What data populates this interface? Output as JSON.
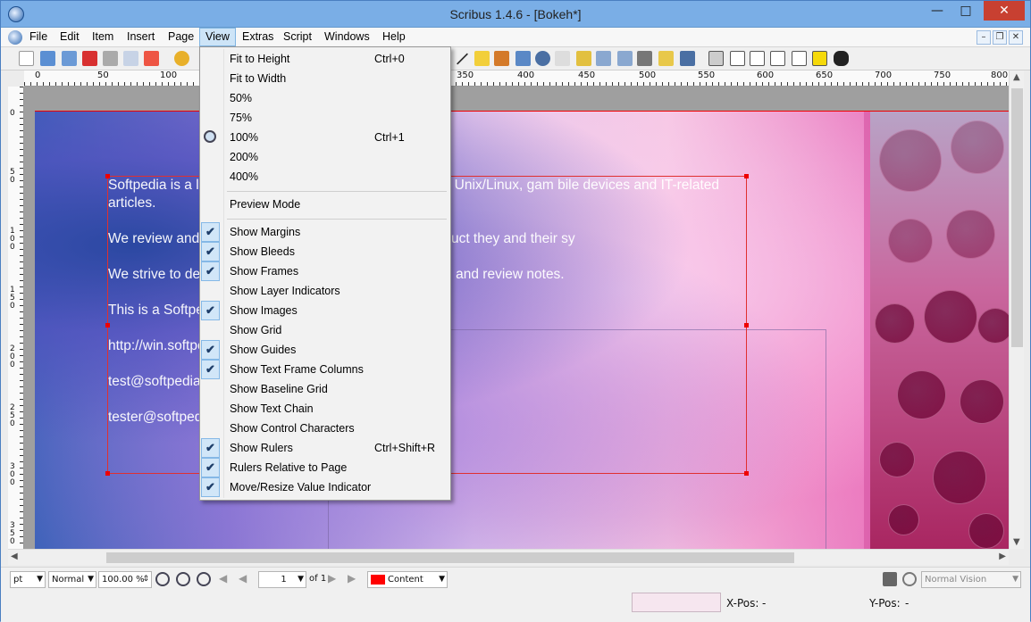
{
  "window": {
    "title": "Scribus 1.4.6 - [Bokeh*]"
  },
  "menubar": {
    "items": [
      {
        "label": "File"
      },
      {
        "label": "Edit"
      },
      {
        "label": "Item"
      },
      {
        "label": "Insert"
      },
      {
        "label": "Page"
      },
      {
        "label": "View"
      },
      {
        "label": "Extras"
      },
      {
        "label": "Script"
      },
      {
        "label": "Windows"
      },
      {
        "label": "Help"
      }
    ],
    "active": "View"
  },
  "ruler": {
    "h_labels": [
      "0",
      "50",
      "100",
      "350",
      "400",
      "450",
      "500",
      "550",
      "600",
      "650",
      "700",
      "750",
      "800"
    ],
    "v_labels": [
      "0",
      "50",
      "100",
      "150",
      "200",
      "250",
      "300",
      "350"
    ]
  },
  "document": {
    "paragraphs": [
      "Softpedia is a lib                                              ry software programs for Windows and Unix/Linux, gam                                          bile devices and IT-related articles.",
      "We review and c                                              w the visitor/user to find the exact product they and their sy",
      "We strive to deli                                              user together with self-made evaluation and review notes.",
      "This is a Softpe",
      "http://win.softpe",
      "test@softpedia.c",
      "tester@softpedi"
    ]
  },
  "view_menu": {
    "items": [
      {
        "label": "Fit to Height",
        "shortcut": "Ctrl+0",
        "checked": false
      },
      {
        "label": "Fit to Width",
        "shortcut": "",
        "checked": false
      },
      {
        "label": "50%",
        "shortcut": "",
        "checked": false
      },
      {
        "label": "75%",
        "shortcut": "",
        "checked": false
      },
      {
        "label": "100%",
        "shortcut": "Ctrl+1",
        "checked": false,
        "icon": "zoom-icon"
      },
      {
        "label": "200%",
        "shortcut": "",
        "checked": false
      },
      {
        "label": "400%",
        "shortcut": "",
        "checked": false
      },
      {
        "label": "Preview Mode",
        "shortcut": "",
        "checked": false
      },
      {
        "label": "Show Margins",
        "shortcut": "",
        "checked": true
      },
      {
        "label": "Show Bleeds",
        "shortcut": "",
        "checked": true
      },
      {
        "label": "Show Frames",
        "shortcut": "",
        "checked": true
      },
      {
        "label": "Show Layer Indicators",
        "shortcut": "",
        "checked": false
      },
      {
        "label": "Show Images",
        "shortcut": "",
        "checked": true
      },
      {
        "label": "Show Grid",
        "shortcut": "",
        "checked": false
      },
      {
        "label": "Show Guides",
        "shortcut": "",
        "checked": true
      },
      {
        "label": "Show Text Frame Columns",
        "shortcut": "",
        "checked": true
      },
      {
        "label": "Show Baseline Grid",
        "shortcut": "",
        "checked": false
      },
      {
        "label": "Show Text Chain",
        "shortcut": "",
        "checked": false
      },
      {
        "label": "Show Control Characters",
        "shortcut": "",
        "checked": false
      },
      {
        "label": "Show Rulers",
        "shortcut": "Ctrl+Shift+R",
        "checked": true
      },
      {
        "label": "Rulers Relative to Page",
        "shortcut": "",
        "checked": true
      },
      {
        "label": "Move/Resize Value Indicator",
        "shortcut": "",
        "checked": true
      }
    ]
  },
  "bottom": {
    "unit": "pt",
    "mode": "Normal",
    "zoom": "100.00 %",
    "page": "1",
    "page_of": "of 1",
    "layer": "Content",
    "vision": "Normal Vision"
  },
  "status": {
    "x_label": "X-Pos:",
    "x_value": "-",
    "y_label": "Y-Pos:",
    "y_value": "-"
  },
  "colors": {
    "accent": "#7aaee6",
    "selection": "#e03030",
    "close": "#c84031"
  }
}
